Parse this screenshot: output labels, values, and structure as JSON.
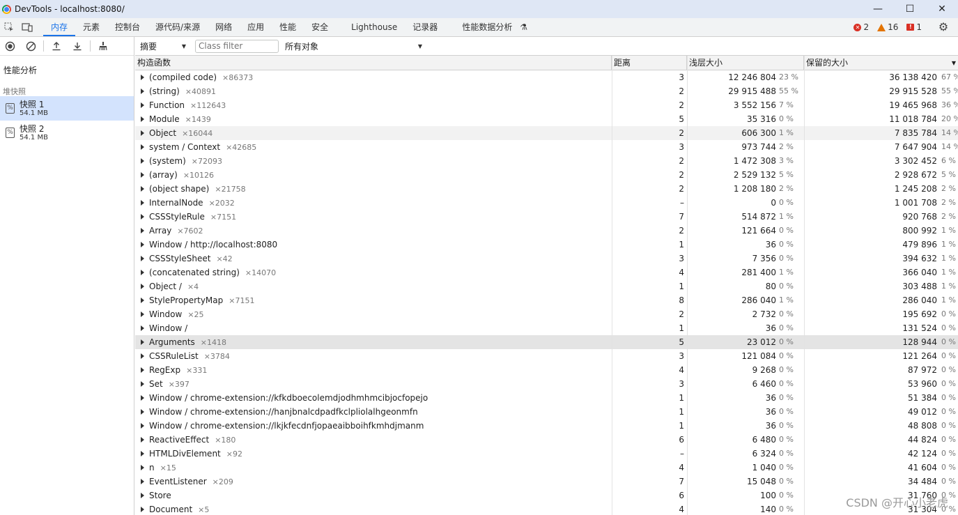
{
  "window": {
    "title": "DevTools - localhost:8080/",
    "minimize_glyph": "—",
    "maximize_glyph": "☐",
    "close_glyph": "✕"
  },
  "tabs": [
    "内存",
    "元素",
    "控制台",
    "源代码/来源",
    "网络",
    "应用",
    "性能",
    "安全",
    "Lighthouse",
    "记录器",
    "性能数据分析"
  ],
  "status": {
    "errors": "2",
    "warnings": "16",
    "issues": "1"
  },
  "sidebar": {
    "profiles_title": "性能分析",
    "heap_section": "堆快照",
    "snapshots": [
      {
        "name": "快照 1",
        "size": "54.1 MB"
      },
      {
        "name": "快照 2",
        "size": "54.1 MB"
      }
    ]
  },
  "filters": {
    "view": "摘要",
    "class_filter_placeholder": "Class filter",
    "objects": "所有对象"
  },
  "columns": {
    "constructor": "构造函数",
    "distance": "距离",
    "shallow": "浅层大小",
    "retained": "保留的大小"
  },
  "rows": [
    {
      "name": "(compiled code)",
      "count": "×86373",
      "distance": "3",
      "shallow": "12 246 804",
      "shallow_pct": "23 %",
      "retained": "36 138 420",
      "retained_pct": "67 %"
    },
    {
      "name": "(string)",
      "count": "×40891",
      "distance": "2",
      "shallow": "29 915 488",
      "shallow_pct": "55 %",
      "retained": "29 915 528",
      "retained_pct": "55 %"
    },
    {
      "name": "Function",
      "count": "×112643",
      "distance": "2",
      "shallow": "3 552 156",
      "shallow_pct": "7 %",
      "retained": "19 465 968",
      "retained_pct": "36 %"
    },
    {
      "name": "Module",
      "count": "×1439",
      "distance": "5",
      "shallow": "35 316",
      "shallow_pct": "0 %",
      "retained": "11 018 784",
      "retained_pct": "20 %"
    },
    {
      "name": "Object",
      "count": "×16044",
      "distance": "2",
      "shallow": "606 300",
      "shallow_pct": "1 %",
      "retained": "7 835 784",
      "retained_pct": "14 %"
    },
    {
      "name": "system / Context",
      "count": "×42685",
      "distance": "3",
      "shallow": "973 744",
      "shallow_pct": "2 %",
      "retained": "7 647 904",
      "retained_pct": "14 %"
    },
    {
      "name": "(system)",
      "count": "×72093",
      "distance": "2",
      "shallow": "1 472 308",
      "shallow_pct": "3 %",
      "retained": "3 302 452",
      "retained_pct": "6 %"
    },
    {
      "name": "(array)",
      "count": "×10126",
      "distance": "2",
      "shallow": "2 529 132",
      "shallow_pct": "5 %",
      "retained": "2 928 672",
      "retained_pct": "5 %"
    },
    {
      "name": "(object shape)",
      "count": "×21758",
      "distance": "2",
      "shallow": "1 208 180",
      "shallow_pct": "2 %",
      "retained": "1 245 208",
      "retained_pct": "2 %"
    },
    {
      "name": "InternalNode",
      "count": "×2032",
      "distance": "–",
      "shallow": "0",
      "shallow_pct": "0 %",
      "retained": "1 001 708",
      "retained_pct": "2 %"
    },
    {
      "name": "CSSStyleRule",
      "count": "×7151",
      "distance": "7",
      "shallow": "514 872",
      "shallow_pct": "1 %",
      "retained": "920 768",
      "retained_pct": "2 %"
    },
    {
      "name": "Array",
      "count": "×7602",
      "distance": "2",
      "shallow": "121 664",
      "shallow_pct": "0 %",
      "retained": "800 992",
      "retained_pct": "1 %"
    },
    {
      "name": "Window / http://localhost:8080",
      "count": "",
      "distance": "1",
      "shallow": "36",
      "shallow_pct": "0 %",
      "retained": "479 896",
      "retained_pct": "1 %"
    },
    {
      "name": "CSSStyleSheet",
      "count": "×42",
      "distance": "3",
      "shallow": "7 356",
      "shallow_pct": "0 %",
      "retained": "394 632",
      "retained_pct": "1 %"
    },
    {
      "name": "(concatenated string)",
      "count": "×14070",
      "distance": "4",
      "shallow": "281 400",
      "shallow_pct": "1 %",
      "retained": "366 040",
      "retained_pct": "1 %"
    },
    {
      "name": "Object /",
      "count": "×4",
      "distance": "1",
      "shallow": "80",
      "shallow_pct": "0 %",
      "retained": "303 488",
      "retained_pct": "1 %"
    },
    {
      "name": "StylePropertyMap",
      "count": "×7151",
      "distance": "8",
      "shallow": "286 040",
      "shallow_pct": "1 %",
      "retained": "286 040",
      "retained_pct": "1 %"
    },
    {
      "name": "Window",
      "count": "×25",
      "distance": "2",
      "shallow": "2 732",
      "shallow_pct": "0 %",
      "retained": "195 692",
      "retained_pct": "0 %"
    },
    {
      "name": "Window /",
      "count": "",
      "distance": "1",
      "shallow": "36",
      "shallow_pct": "0 %",
      "retained": "131 524",
      "retained_pct": "0 %"
    },
    {
      "name": "Arguments",
      "count": "×1418",
      "distance": "5",
      "shallow": "23 012",
      "shallow_pct": "0 %",
      "retained": "128 944",
      "retained_pct": "0 %"
    },
    {
      "name": "CSSRuleList",
      "count": "×3784",
      "distance": "3",
      "shallow": "121 084",
      "shallow_pct": "0 %",
      "retained": "121 264",
      "retained_pct": "0 %"
    },
    {
      "name": "RegExp",
      "count": "×331",
      "distance": "4",
      "shallow": "9 268",
      "shallow_pct": "0 %",
      "retained": "87 972",
      "retained_pct": "0 %"
    },
    {
      "name": "Set",
      "count": "×397",
      "distance": "3",
      "shallow": "6 460",
      "shallow_pct": "0 %",
      "retained": "53 960",
      "retained_pct": "0 %"
    },
    {
      "name": "Window / chrome-extension://kfkdboecolemdjodhmhmcibjocfopejo",
      "count": "",
      "distance": "1",
      "shallow": "36",
      "shallow_pct": "0 %",
      "retained": "51 384",
      "retained_pct": "0 %"
    },
    {
      "name": "Window / chrome-extension://hanjbnalcdpadfkclpliolalhgeonmfn",
      "count": "",
      "distance": "1",
      "shallow": "36",
      "shallow_pct": "0 %",
      "retained": "49 012",
      "retained_pct": "0 %"
    },
    {
      "name": "Window / chrome-extension://lkjkfecdnfjopaeaibboihfkmhdjmanm",
      "count": "",
      "distance": "1",
      "shallow": "36",
      "shallow_pct": "0 %",
      "retained": "48 808",
      "retained_pct": "0 %"
    },
    {
      "name": "ReactiveEffect",
      "count": "×180",
      "distance": "6",
      "shallow": "6 480",
      "shallow_pct": "0 %",
      "retained": "44 824",
      "retained_pct": "0 %"
    },
    {
      "name": "HTMLDivElement",
      "count": "×92",
      "distance": "–",
      "shallow": "6 324",
      "shallow_pct": "0 %",
      "retained": "42 124",
      "retained_pct": "0 %"
    },
    {
      "name": "n",
      "count": "×15",
      "distance": "4",
      "shallow": "1 040",
      "shallow_pct": "0 %",
      "retained": "41 604",
      "retained_pct": "0 %"
    },
    {
      "name": "EventListener",
      "count": "×209",
      "distance": "7",
      "shallow": "15 048",
      "shallow_pct": "0 %",
      "retained": "34 484",
      "retained_pct": "0 %"
    },
    {
      "name": "Store",
      "count": "",
      "distance": "6",
      "shallow": "100",
      "shallow_pct": "0 %",
      "retained": "31 760",
      "retained_pct": "0 %"
    },
    {
      "name": "Document",
      "count": "×5",
      "distance": "4",
      "shallow": "140",
      "shallow_pct": "0 %",
      "retained": "31 304",
      "retained_pct": "0 %"
    }
  ],
  "watermark": "CSDN @开心小老虎"
}
